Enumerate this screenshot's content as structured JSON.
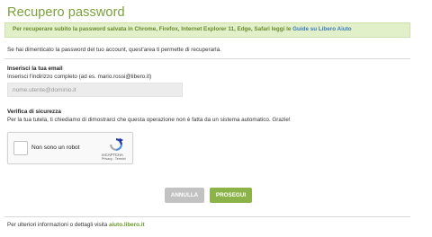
{
  "page": {
    "title": "Recupero password"
  },
  "banner": {
    "text": "Per recuperare subito la password salvata in Chrome, Firefox, Internet Explorer 11, Edge, Safari leggi le ",
    "link": "Guide su Libero Aiuto"
  },
  "intro": "Se hai dimenticato la password del tuo account, quest'area ti permette di recuperarla.",
  "email": {
    "label": "Inserisci la tua email",
    "help": "Inserisci l'indirizzo completo (ad es. mario.rossi@libero.it)",
    "placeholder": "nome.utente@dominio.it",
    "value": ""
  },
  "verify": {
    "label": "Verifica di sicurezza",
    "help": "Per la tua tutela, ti chiediamo di dimostrarci che questa operazione non è fatta da un sistema automatico. Grazie!"
  },
  "recaptcha": {
    "checkbox_label": "Non sono un robot",
    "brand": "reCAPTCHA",
    "links": "Privacy - Termini",
    "logo_icon": "recaptcha-logo-icon",
    "checked": false
  },
  "buttons": {
    "cancel": "ANNULLA",
    "next": "PROSEGUI"
  },
  "footer": {
    "text": "Per ulteriori informazioni o dettagli visita ",
    "link": "aiuto.libero.it"
  },
  "colors": {
    "brand_green": "#7ba03a",
    "banner_bg": "#e2f0c9",
    "link_blue": "#3f7bc1",
    "button_green": "#8cb349",
    "button_grey": "#c2c2c2"
  }
}
